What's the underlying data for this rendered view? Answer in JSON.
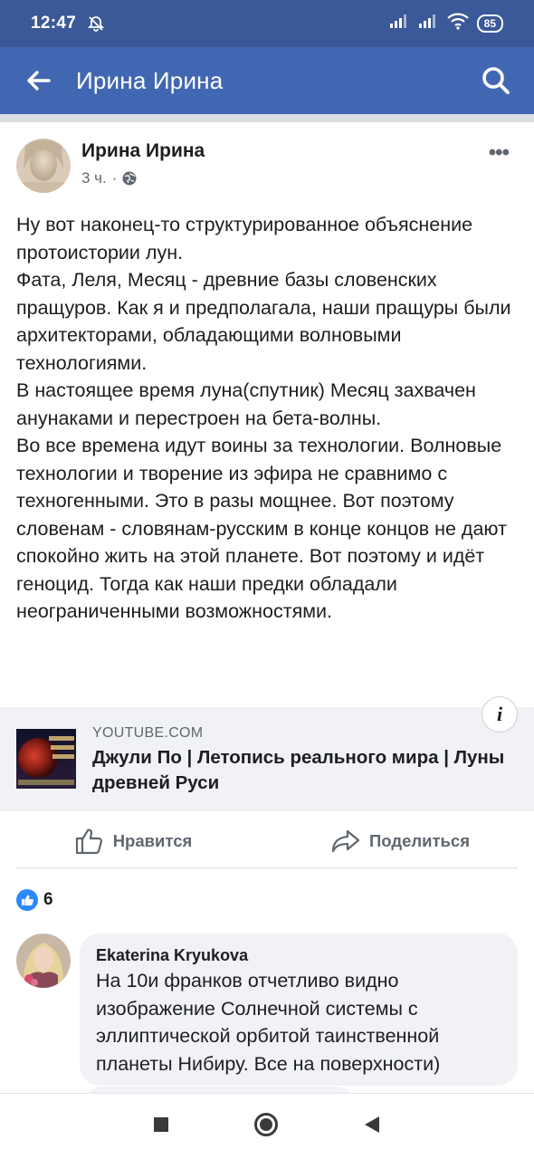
{
  "status_bar": {
    "time": "12:47",
    "battery": "85",
    "icons": [
      "mute-icon",
      "signal-icon",
      "signal-icon",
      "wifi-icon",
      "battery-icon"
    ]
  },
  "app_bar": {
    "title": "Ирина Ирина",
    "back_icon": "arrow-left-icon",
    "search_icon": "search-icon"
  },
  "post": {
    "author": "Ирина Ирина",
    "time": "3 ч.",
    "separator": "·",
    "privacy_icon": "globe-icon",
    "more_icon": "more-horizontal-icon",
    "text_lines": [
      "Ну вот наконец-то структурированное объяснение протоистории лун.",
      "Фата, Леля, Месяц - древние базы словенских пращуров. Как я и предполагала, наши пращуры были архитекторами, обладающими волновыми технологиями.",
      "В настоящее время луна(спутник) Месяц захвачен анунаками и перестроен на бета-волны.",
      "Во все времена идут воины за технологии. Волновые технологии и творение из эфира не сравнимо с техногенными. Это в разы мощнее. Вот поэтому словенам - словянам-русским в конце концов не дают спокойно жить на этой планете. Вот поэтому и идёт геноцид. Тогда как наши предки обладали неограниченными возможностями."
    ],
    "link": {
      "domain": "YOUTUBE.COM",
      "title": "Джули По | Летопись реального мира | Луны древней Руси",
      "info": "i"
    },
    "actions": {
      "like": "Нравится",
      "share": "Поделиться"
    },
    "reactions": {
      "count": "6"
    }
  },
  "comment": {
    "author": "Ekaterina Kryukova",
    "text": "На 10и франков отчетливо видно изображение Солнечной системы с эллиптической орбитой таинственной планеты Нибиру. Все на поверхности)"
  },
  "nav": {
    "icons": [
      "recent-apps-icon",
      "home-icon",
      "back-triangle-icon"
    ]
  }
}
